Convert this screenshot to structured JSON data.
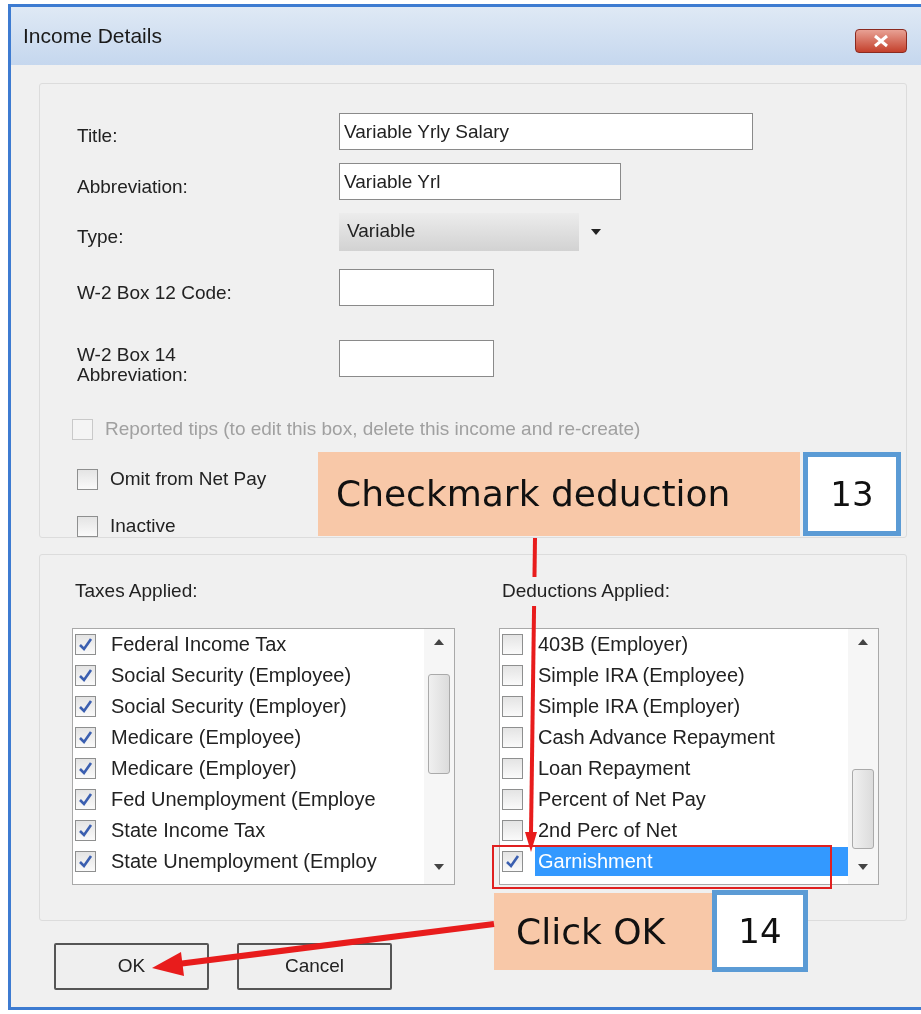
{
  "window": {
    "title": "Income Details"
  },
  "fields": [
    {
      "label": "Title:",
      "value": "Variable Yrly Salary",
      "kind": "text"
    },
    {
      "label": "Abbreviation:",
      "value": "Variable Yrl",
      "kind": "text"
    },
    {
      "label": "Type:",
      "value": "Variable",
      "kind": "dropdown"
    },
    {
      "label": "W-2 Box 12 Code:",
      "kind": "text"
    },
    {
      "label": "W-2 Box 14 Abbreviation:",
      "kind": "text"
    }
  ],
  "options": [
    {
      "label": "Reported tips (to edit this box, delete this income and re-create)",
      "checked": false,
      "disabled": true
    },
    {
      "label": "Omit from Net Pay",
      "checked": false,
      "disabled": false
    },
    {
      "label": "Inactive",
      "checked": false,
      "disabled": false
    }
  ],
  "taxes": {
    "label": "Taxes Applied:",
    "items": [
      {
        "label": "Federal Income Tax",
        "checked": true,
        "selected": false
      },
      {
        "label": "Social Security (Employee)",
        "checked": true,
        "selected": false
      },
      {
        "label": "Social Security (Employer)",
        "checked": true,
        "selected": false
      },
      {
        "label": "Medicare (Employee)",
        "checked": true,
        "selected": false
      },
      {
        "label": "Medicare (Employer)",
        "checked": true,
        "selected": false
      },
      {
        "label": "Fed Unemployment (Employe",
        "checked": true,
        "selected": false
      },
      {
        "label": "State Income Tax",
        "checked": true,
        "selected": false
      },
      {
        "label": "State Unemployment (Employ",
        "checked": true,
        "selected": false
      }
    ]
  },
  "deductions": {
    "label": "Deductions Applied:",
    "items": [
      {
        "label": "403B (Employer)",
        "checked": false,
        "selected": false
      },
      {
        "label": "Simple IRA (Employee)",
        "checked": false,
        "selected": false
      },
      {
        "label": "Simple IRA (Employer)",
        "checked": false,
        "selected": false
      },
      {
        "label": "Cash Advance Repayment",
        "checked": false,
        "selected": false
      },
      {
        "label": "Loan Repayment",
        "checked": false,
        "selected": false
      },
      {
        "label": "Percent of Net Pay",
        "checked": false,
        "selected": false
      },
      {
        "label": "2nd Perc of Net",
        "checked": false,
        "selected": false
      },
      {
        "label": "Garnishment",
        "checked": true,
        "selected": true
      }
    ]
  },
  "buttons": [
    {
      "label": "OK"
    },
    {
      "label": "Cancel"
    }
  ],
  "annotations": [
    {
      "text": "Checkmark deduction",
      "step": "13"
    },
    {
      "text": "Click OK",
      "step": "14"
    }
  ]
}
